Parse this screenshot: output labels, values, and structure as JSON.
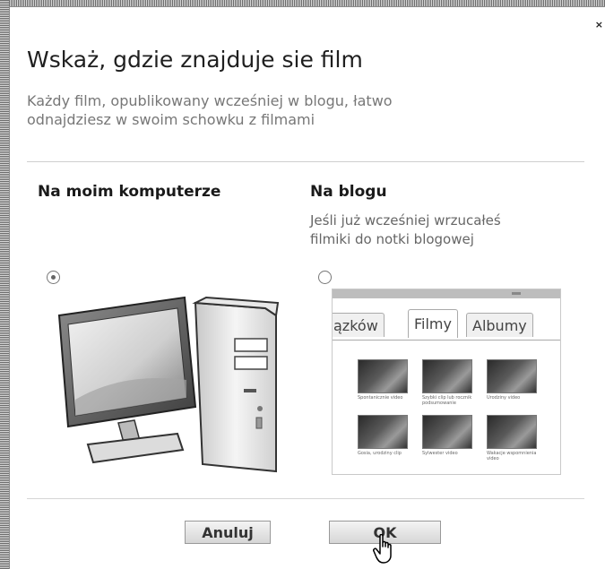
{
  "dialog": {
    "title": "Wskaż, gdzie znajduje sie film",
    "subtitle": "Każdy film, opublikowany wcześniej w blogu, łatwo\nodnajdziesz w swoim schowku z filmami",
    "close_label": "×"
  },
  "options": {
    "computer": {
      "heading": "Na moim komputerze",
      "selected": true
    },
    "blog": {
      "heading": "Na blogu",
      "description": "Jeśli już wcześniej wrzucałeś\nfilmiki do notki blogowej",
      "selected": false,
      "preview_tabs": [
        "ązków",
        "Filmy",
        "Albumy"
      ],
      "active_tab": "Filmy",
      "thumbnails": [
        {
          "caption": "Spontanicznie video"
        },
        {
          "caption": "Szybki clip lub rocznik podsumowanie"
        },
        {
          "caption": "Urodziny video"
        },
        {
          "caption": "Gosia, urodziny clip"
        },
        {
          "caption": "Sylwester video"
        },
        {
          "caption": "Wakacje wspomnienia video"
        }
      ]
    }
  },
  "buttons": {
    "cancel": "Anuluj",
    "ok": "OK"
  },
  "colors": {
    "button_top": "#f4f4f4",
    "button_bottom": "#d6d6d6",
    "title_text": "#1f1f1f",
    "subtitle_text": "#777777"
  }
}
